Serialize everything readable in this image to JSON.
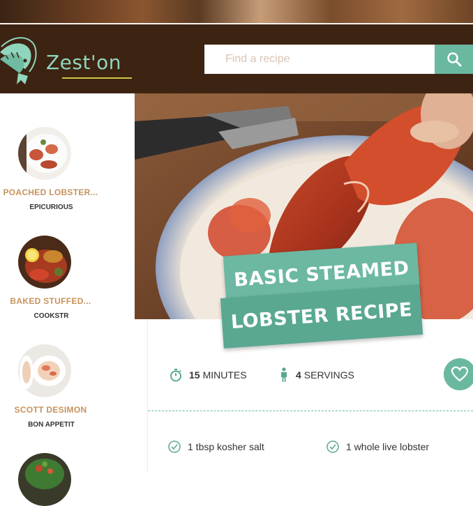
{
  "header": {
    "logo_text": "Zest'on",
    "search_placeholder": "Find a recipe"
  },
  "sidebar": {
    "items": [
      {
        "title": "POACHED LOBSTER...",
        "source": "EPICURIOUS"
      },
      {
        "title": "BAKED STUFFED...",
        "source": "COOKSTR"
      },
      {
        "title": "SCOTT DESIMON",
        "source": "BON APPETIT"
      }
    ]
  },
  "recipe": {
    "title_line1": "BASIC STEAMED",
    "title_line2": "LOBSTER RECIPE",
    "time_value": "15",
    "time_unit": "MINUTES",
    "servings_value": "4",
    "servings_unit": "SERVINGS",
    "ingredients": [
      "1 tbsp kosher salt",
      "1 whole live lobster"
    ]
  },
  "colors": {
    "header_bg": "#3d2312",
    "accent": "#6ab8a0",
    "title_gold": "#c6935a"
  }
}
